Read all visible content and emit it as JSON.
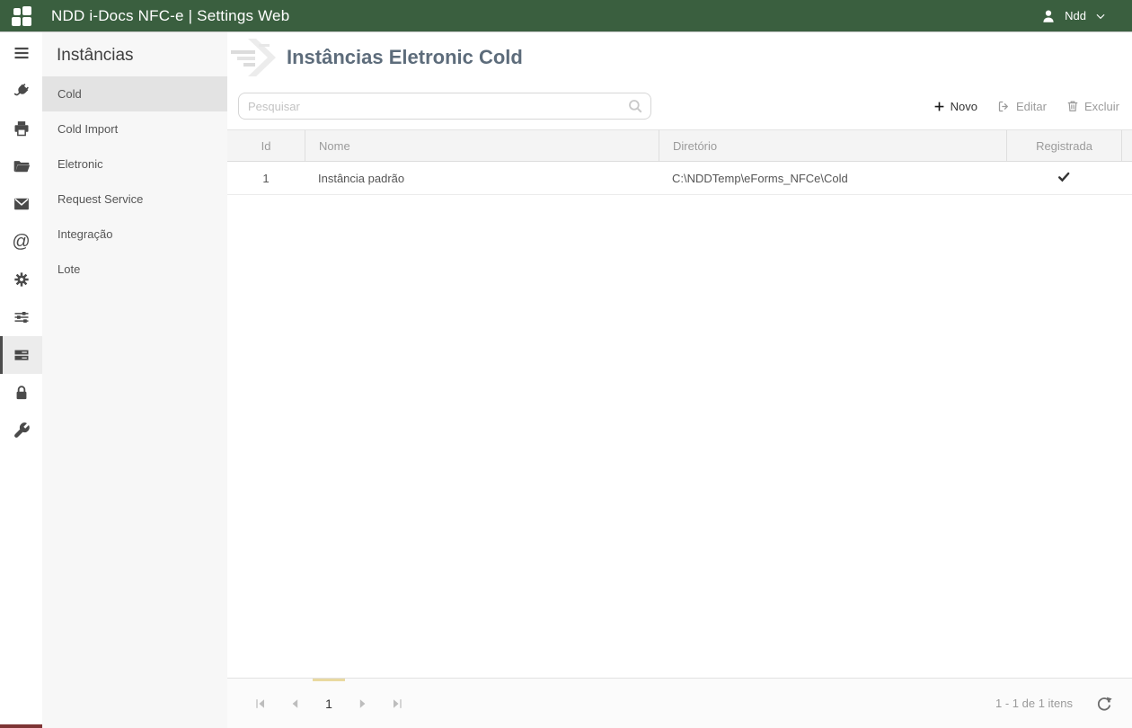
{
  "topbar": {
    "title": "NDD i-Docs NFC-e | Settings Web",
    "user_name": "Ndd"
  },
  "iconbar": {
    "at_glyph": "@",
    "icons": [
      "menu",
      "plug",
      "printer",
      "folder-open",
      "mail",
      "at-sign",
      "gear",
      "sliders",
      "instances",
      "lock",
      "wrench"
    ],
    "active_icon": "instances"
  },
  "sidebar": {
    "title": "Instâncias",
    "items": [
      {
        "label": "Cold",
        "active": true
      },
      {
        "label": "Cold Import",
        "active": false
      },
      {
        "label": "Eletronic",
        "active": false
      },
      {
        "label": "Request Service",
        "active": false
      },
      {
        "label": "Integração",
        "active": false
      },
      {
        "label": "Lote",
        "active": false
      }
    ]
  },
  "main": {
    "page_title": "Instâncias Eletronic Cold",
    "toolbar": {
      "search_placeholder": "Pesquisar",
      "new_label": "Novo",
      "edit_label": "Editar",
      "delete_label": "Excluir"
    },
    "table": {
      "columns": [
        "Id",
        "Nome",
        "Diretório",
        "Registrada"
      ],
      "rows": [
        {
          "id": "1",
          "nome": "Instância padrão",
          "diretorio": "C:\\NDDTemp\\eForms_NFCe\\Cold",
          "registrada": true
        }
      ]
    },
    "pager": {
      "current_page": "1",
      "info": "1 - 1 de 1 itens"
    }
  },
  "colors": {
    "topbar_green": "#3a5f3f",
    "page_indicator_tan": "#e9d9a0",
    "rail_bottom_maroon": "#7d3434"
  }
}
